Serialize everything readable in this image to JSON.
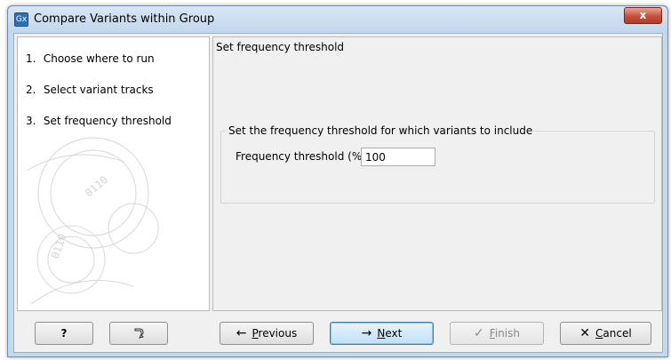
{
  "window": {
    "app_icon": "Gx",
    "title": "Compare Variants within Group",
    "close_icon": "x"
  },
  "steps": [
    {
      "num": "1.",
      "label": "Choose where to run"
    },
    {
      "num": "2.",
      "label": "Select variant tracks"
    },
    {
      "num": "3.",
      "label": "Set frequency threshold"
    }
  ],
  "main": {
    "heading": "Set frequency threshold",
    "group_title": "Set the frequency threshold for which variants to include",
    "field_label": "Frequency threshold (%)",
    "field_value": "100"
  },
  "buttons": {
    "help": "?",
    "reset_icon": "reset-arrow-icon",
    "previous_first": "P",
    "previous_rest": "revious",
    "next_first": "N",
    "next_rest": "ext",
    "finish_first": "F",
    "finish_rest": "inish",
    "cancel_first": "C",
    "cancel_rest": "ancel"
  },
  "colors": {
    "title_bar": "#c2d6ec",
    "close_button": "#c8503a",
    "default_button_border": "#3c7fb1"
  }
}
